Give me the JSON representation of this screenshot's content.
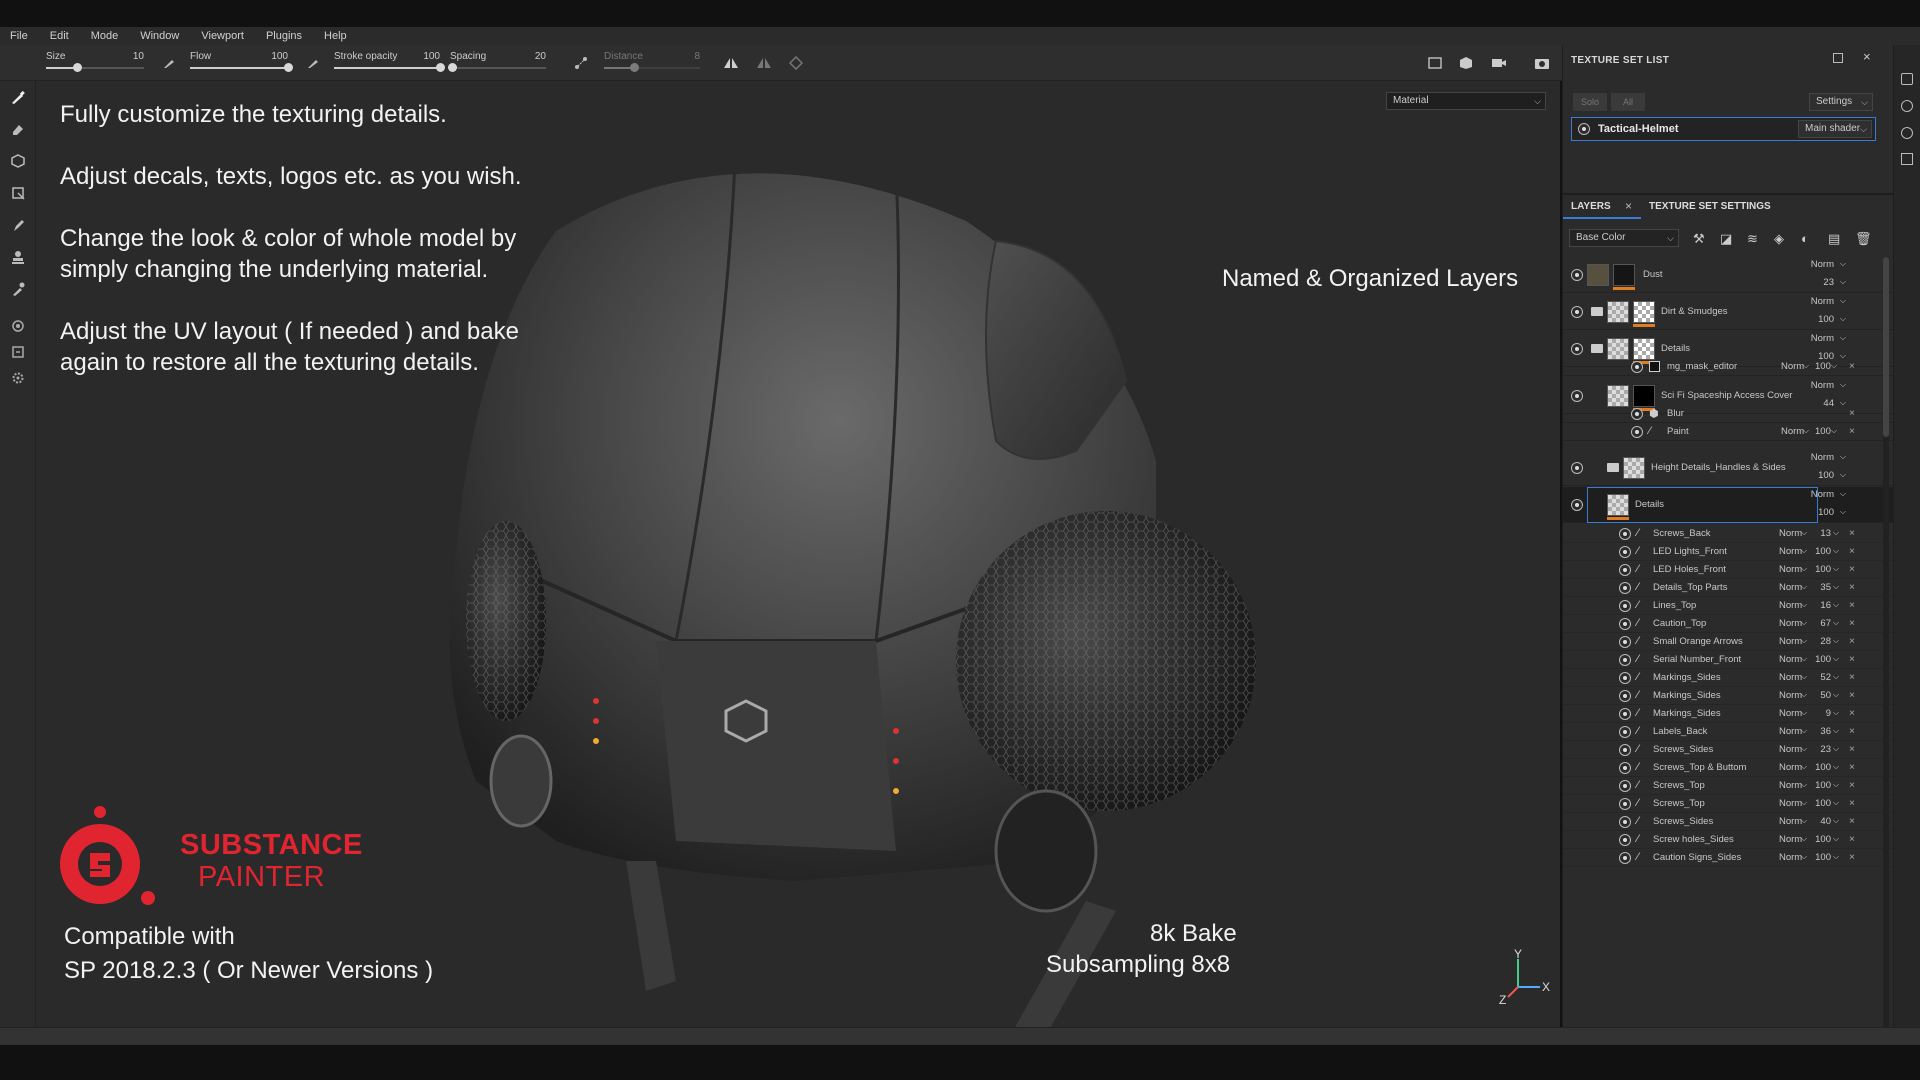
{
  "menu": [
    "File",
    "Edit",
    "Mode",
    "Window",
    "Viewport",
    "Plugins",
    "Help"
  ],
  "toolbar": {
    "size_label": "Size",
    "size_value": "10",
    "flow_label": "Flow",
    "flow_value": "100",
    "opacity_label": "Stroke opacity",
    "opacity_value": "100",
    "spacing_label": "Spacing",
    "spacing_value": "20",
    "distance_label": "Distance",
    "distance_value": "8"
  },
  "viewport": {
    "material_select": "Material",
    "text1": "Fully customize the texturing details.",
    "text2": "Adjust decals, texts, logos etc. as you wish.",
    "text3a": "Change the look & color of whole model by",
    "text3b": "simply changing the underlying material.",
    "text4a": "Adjust the UV layout ( If needed ) and bake",
    "text4b": "again to restore all the texturing details.",
    "layers_caption": "Named & Organized Layers",
    "logo_line1": "SUBSTANCE",
    "logo_line2": "PAINTER",
    "compat1": "Compatible with",
    "compat2": "SP 2018.2.3 ( Or Newer Versions )",
    "bake1": "8k Bake",
    "bake2": "Subsampling 8x8",
    "axis_y": "Y",
    "axis_x": "X",
    "axis_z": "Z",
    "brand_color": "#e02530"
  },
  "texture_set_list": {
    "title": "TEXTURE SET LIST",
    "solo": "Solo",
    "all": "All",
    "settings": "Settings",
    "set_name": "Tactical-Helmet",
    "shader": "Main shader"
  },
  "layers_panel": {
    "tab_layers": "LAYERS",
    "tab_settings": "TEXTURE SET SETTINGS",
    "channel": "Base Color",
    "top_layers": [
      {
        "name": "Dust",
        "blend": "Norm",
        "opacity": "23"
      },
      {
        "name": "Dirt & Smudges",
        "blend": "Norm",
        "opacity": "100"
      },
      {
        "name": "Details",
        "blend": "Norm",
        "opacity": "100"
      },
      {
        "name": "mg_mask_editor",
        "blend": "Norm",
        "opacity": "100"
      },
      {
        "name": "Sci Fi Spaceship Access Cover",
        "blend": "Norm",
        "opacity": "44"
      },
      {
        "name": "Blur"
      },
      {
        "name": "Paint",
        "blend": "Norm",
        "opacity": "100"
      },
      {
        "name": "Height Details_Handles & Sides",
        "blend": "Norm",
        "opacity": "100"
      },
      {
        "name": "Details",
        "blend": "Norm",
        "opacity": "100"
      }
    ],
    "sublayers": [
      {
        "name": "Screws_Back",
        "blend": "Norm",
        "opacity": "13"
      },
      {
        "name": "LED Lights_Front",
        "blend": "Norm",
        "opacity": "100"
      },
      {
        "name": "LED Holes_Front",
        "blend": "Norm",
        "opacity": "100"
      },
      {
        "name": "Details_Top Parts",
        "blend": "Norm",
        "opacity": "35"
      },
      {
        "name": "Lines_Top",
        "blend": "Norm",
        "opacity": "16"
      },
      {
        "name": "Caution_Top",
        "blend": "Norm",
        "opacity": "67"
      },
      {
        "name": "Small Orange Arrows",
        "blend": "Norm",
        "opacity": "28"
      },
      {
        "name": "Serial Number_Front",
        "blend": "Norm",
        "opacity": "100"
      },
      {
        "name": "Markings_Sides",
        "blend": "Norm",
        "opacity": "52"
      },
      {
        "name": "Markings_Sides",
        "blend": "Norm",
        "opacity": "50"
      },
      {
        "name": "Markings_Sides",
        "blend": "Norm",
        "opacity": "9"
      },
      {
        "name": "Labels_Back",
        "blend": "Norm",
        "opacity": "36"
      },
      {
        "name": "Screws_Sides",
        "blend": "Norm",
        "opacity": "23"
      },
      {
        "name": "Screws_Top & Buttom",
        "blend": "Norm",
        "opacity": "100"
      },
      {
        "name": "Screws_Top",
        "blend": "Norm",
        "opacity": "100"
      },
      {
        "name": "Screws_Top",
        "blend": "Norm",
        "opacity": "100"
      },
      {
        "name": "Screws_Sides",
        "blend": "Norm",
        "opacity": "40"
      },
      {
        "name": "Screw holes_Sides",
        "blend": "Norm",
        "opacity": "100"
      },
      {
        "name": "Caution Signs_Sides",
        "blend": "Norm",
        "opacity": "100"
      }
    ]
  }
}
